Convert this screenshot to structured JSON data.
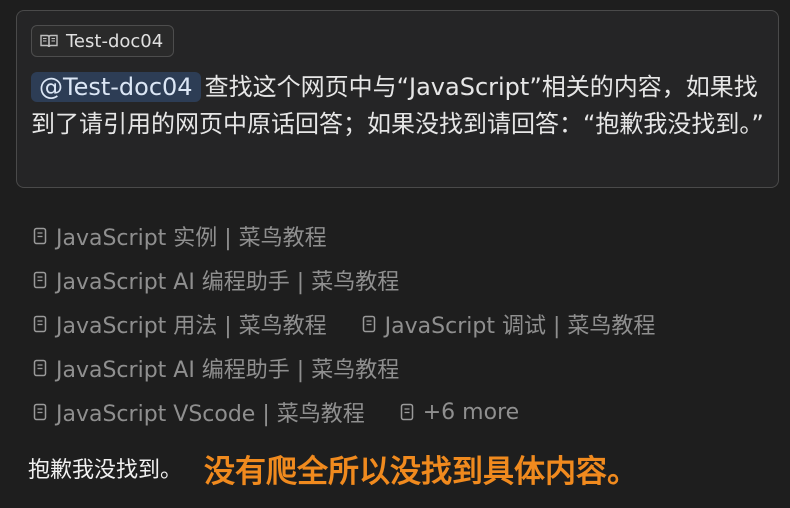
{
  "prompt": {
    "doc_chip_label": "Test-doc04",
    "mention": "@Test-doc04",
    "text": "查找这个网页中与“JavaScript”相关的内容，如果找到了请引用的网页中原话回答；如果没找到请回答：“抱歉我没找到。”"
  },
  "sources": {
    "rows": [
      [
        "JavaScript 实例 | 菜鸟教程"
      ],
      [
        "JavaScript AI 编程助手 | 菜鸟教程"
      ],
      [
        "JavaScript 用法 | 菜鸟教程",
        "JavaScript 调试 | 菜鸟教程"
      ],
      [
        "JavaScript AI 编程助手 | 菜鸟教程"
      ],
      [
        "JavaScript VScode | 菜鸟教程",
        "+6 more"
      ]
    ]
  },
  "answer": {
    "text": "抱歉我没找到。",
    "annotation": "没有爬全所以没找到具体内容。"
  },
  "colors": {
    "background": "#1e1e1e",
    "card": "#252526",
    "mention_bg": "#2d3d55",
    "source_text": "#8f8f8f",
    "annotation": "#f08a1e"
  },
  "icons": {
    "doc_chip": "book-icon",
    "source": "document-icon"
  }
}
